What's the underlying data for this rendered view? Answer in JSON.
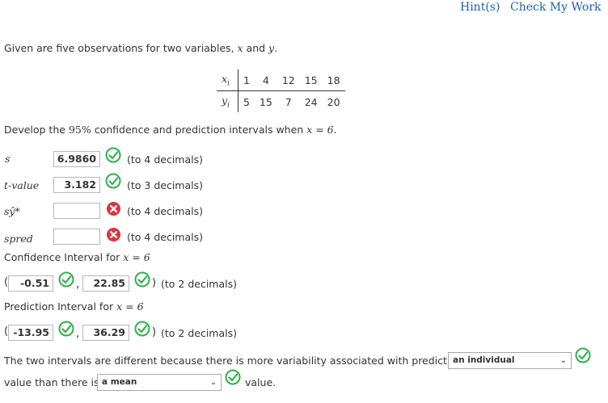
{
  "header": {
    "hint_label": "Hint(s)",
    "check_label": "Check My Work"
  },
  "intro": {
    "prefix": "Given are five observations for two variables,",
    "var_x": "x",
    "and": "and",
    "var_y": "y",
    "period": "."
  },
  "table": {
    "x_label": "xi",
    "y_label": "yi",
    "x_values": [
      "1",
      "4",
      "12",
      "15",
      "18"
    ],
    "y_values": [
      "5",
      "15",
      "7",
      "24",
      "20"
    ]
  },
  "develop": {
    "prefix": "Develop the",
    "pct": "95%",
    "middle": "confidence and prediction intervals when",
    "eq": "x = 6",
    "end": "."
  },
  "rows": {
    "s": {
      "label": "s",
      "value": "6.9860",
      "hint": "(to 4 decimals)",
      "status": "correct"
    },
    "t": {
      "label": "t-value",
      "value": "3.182",
      "hint": "(to 3 decimals)",
      "status": "correct"
    },
    "syhat": {
      "label": "sŷ*",
      "value": "",
      "hint": "(to 4 decimals)",
      "status": "incorrect"
    },
    "spred": {
      "label": "spred",
      "value": "",
      "hint": "(to 4 decimals)",
      "status": "incorrect"
    }
  },
  "ci": {
    "title": "Confidence Interval for",
    "eq": "x = 6",
    "lower": "-0.51",
    "upper": "22.85",
    "hint": "(to 2 decimals)"
  },
  "pi": {
    "title": "Prediction Interval for",
    "eq": "x = 6",
    "lower": "-13.95",
    "upper": "36.29",
    "hint": "(to 2 decimals)"
  },
  "conclusion": {
    "line1": "The two intervals are different because there is more variability associated with predicting",
    "select1": "an individual",
    "line2_prefix": "value than there is",
    "select2": "a mean",
    "line2_suffix": "value."
  },
  "colors": {
    "correct": "#2db34a",
    "incorrect": "#d9363e",
    "link": "#1f5fb0"
  }
}
